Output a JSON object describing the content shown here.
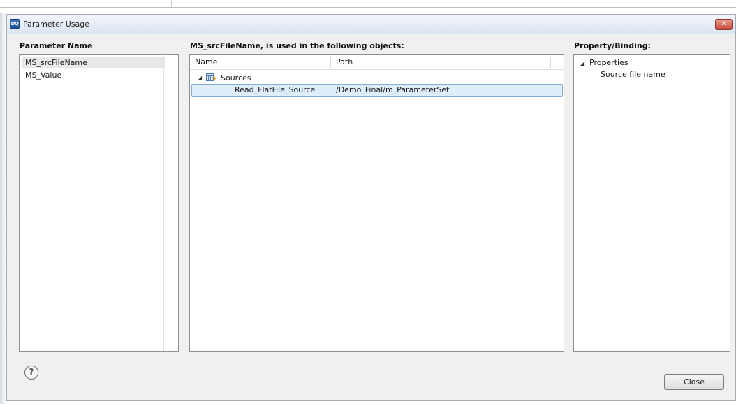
{
  "window": {
    "title": "Parameter Usage",
    "app_icon_text": "DQ",
    "close_glyph": "✕"
  },
  "columns": {
    "parameter_header": "Parameter Name",
    "objects_header": "MS_srcFileName, is used in the following objects:",
    "property_header": "Property/Binding:"
  },
  "parameters": [
    {
      "name": "MS_srcFileName",
      "selected": true
    },
    {
      "name": "MS_Value",
      "selected": false
    }
  ],
  "objects_table": {
    "headers": [
      "Name",
      "Path"
    ],
    "group": {
      "label": "Sources",
      "expanded": true
    },
    "rows": [
      {
        "name": "Read_FlatFile_Source",
        "path": "/Demo_Final/m_ParameterSet",
        "selected": true
      }
    ]
  },
  "property_tree": {
    "group": {
      "label": "Properties",
      "expanded": true
    },
    "items": [
      "Source file name"
    ]
  },
  "footer": {
    "help_glyph": "?",
    "close_label": "Close"
  }
}
